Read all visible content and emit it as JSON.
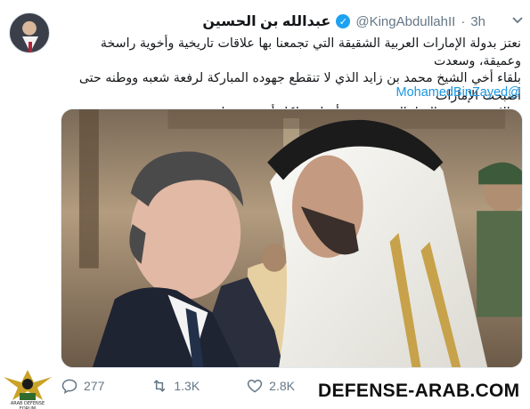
{
  "tweet": {
    "display_name": "عبدالله بن الحسين",
    "handle": "@KingAbdullahII",
    "separator": "·",
    "time": "3h",
    "text_lines": [
      "نعتز بدولة الإمارات العربية الشقيقة التي تجمعنا بها علاقات تاريخية وأخوية راسخة وعميقة، وسعدت",
      "بلقاء أخي الشيخ محمد بن زايد الذي لا تنقطع جهوده المباركة لرفعة شعبه ووطنه حتى أصبحت الإمارات",
      "مثالا يحتذى به عالميا. الشيخ محمد أخ لي ولكل أردني، وقائد عربي نعتز به"
    ],
    "mention": "@MohamedBinZayed",
    "verified_icon": "verified-check-icon",
    "menu_icon": "chevron-down-icon"
  },
  "actions": {
    "reply_count": "277",
    "retweet_count": "1.3K",
    "like_count": "2.8K"
  },
  "watermark": {
    "text": "DEFENSE-ARAB.COM",
    "logo_text": "ARAB DEFENSE FORUM"
  },
  "colors": {
    "accent": "#1da1f2",
    "link": "#1b95e0",
    "muted": "#657786"
  }
}
